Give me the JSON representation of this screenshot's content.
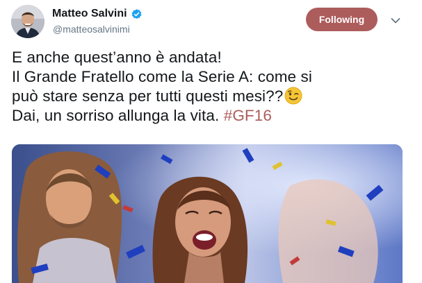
{
  "author": {
    "display_name": "Matteo Salvini",
    "handle": "@matteosalvinimi",
    "verified": true,
    "avatar_icon": "profile-photo"
  },
  "follow_button": {
    "label": "Following",
    "color": "#ad5c5c"
  },
  "menu_icon": "chevron-down-icon",
  "tweet": {
    "line1": "E anche quest’anno è andata!",
    "line2": "Il Grande Fratello come la Serie A: come si",
    "line3": "può stare senza per tutti questi mesi??",
    "emoji": "winking-face",
    "line4_text": "Dai, un sorriso allunga la vita. ",
    "hashtag": "#GF16",
    "hashtag_color": "#ad5c5c"
  },
  "media": {
    "type": "photo",
    "subject": "tv-show-confetti-scene"
  }
}
